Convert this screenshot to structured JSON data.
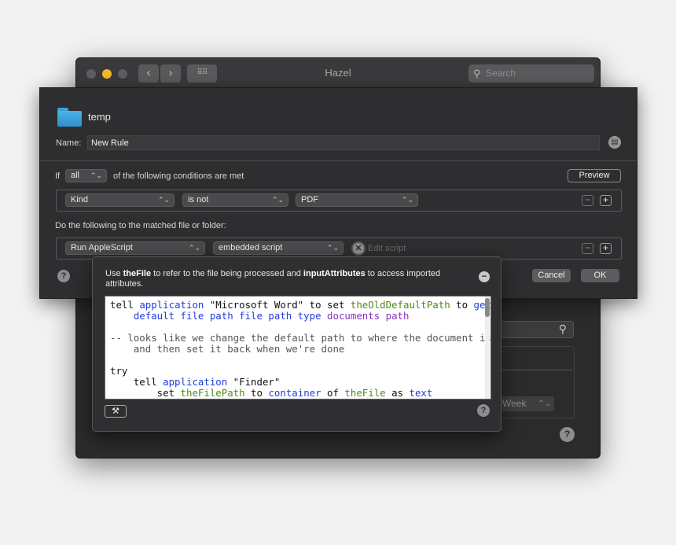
{
  "window": {
    "title": "Hazel",
    "search_placeholder": "Search",
    "nav_back": "‹",
    "nav_forward": "›",
    "grid_icon": "⠿⠿",
    "background": {
      "week_label": "Week",
      "help": "?"
    }
  },
  "rule": {
    "folder_name": "temp",
    "name_label": "Name:",
    "name_value": "New Rule",
    "if_label": "If",
    "match_mode": "all",
    "conditions_text": "of the following conditions are met",
    "preview_label": "Preview",
    "condition": {
      "attribute": "Kind",
      "operator": "is not",
      "value": "PDF"
    },
    "actions_heading": "Do the following to the matched file or folder:",
    "action": {
      "type": "Run AppleScript",
      "source": "embedded script",
      "edit_label": "Edit script"
    },
    "minus": "−",
    "plus": "+",
    "help": "?",
    "cancel_label": "Cancel",
    "ok_label": "OK"
  },
  "popover": {
    "intro_use": "Use ",
    "intro_var1": "theFile",
    "intro_mid": " to refer to the file being processed and ",
    "intro_var2": "inputAttributes",
    "intro_end": " to access imported attributes.",
    "help": "?",
    "hammer_icon": "⚒",
    "code": {
      "l1_a": "tell ",
      "l1_b": "application",
      "l1_c": " \"Microsoft Word\" to set ",
      "l1_d": "theOldDefaultPath",
      "l1_e": " to ",
      "l1_f": "get",
      "l2_a": "    ",
      "l2_b": "default file path file path type",
      "l2_c": " ",
      "l2_d": "documents path",
      "l3": "",
      "l4": "-- looks like we change the default path to where the document is",
      "l5": "    and then set it back when we're done",
      "l6": "",
      "l7": "try",
      "l8_a": "    tell ",
      "l8_b": "application",
      "l8_c": " \"Finder\"",
      "l9_a": "        set ",
      "l9_b": "theFilePath",
      "l9_c": " to ",
      "l9_d": "container",
      "l9_e": " of ",
      "l9_f": "theFile",
      "l9_g": " as ",
      "l9_h": "text"
    }
  }
}
